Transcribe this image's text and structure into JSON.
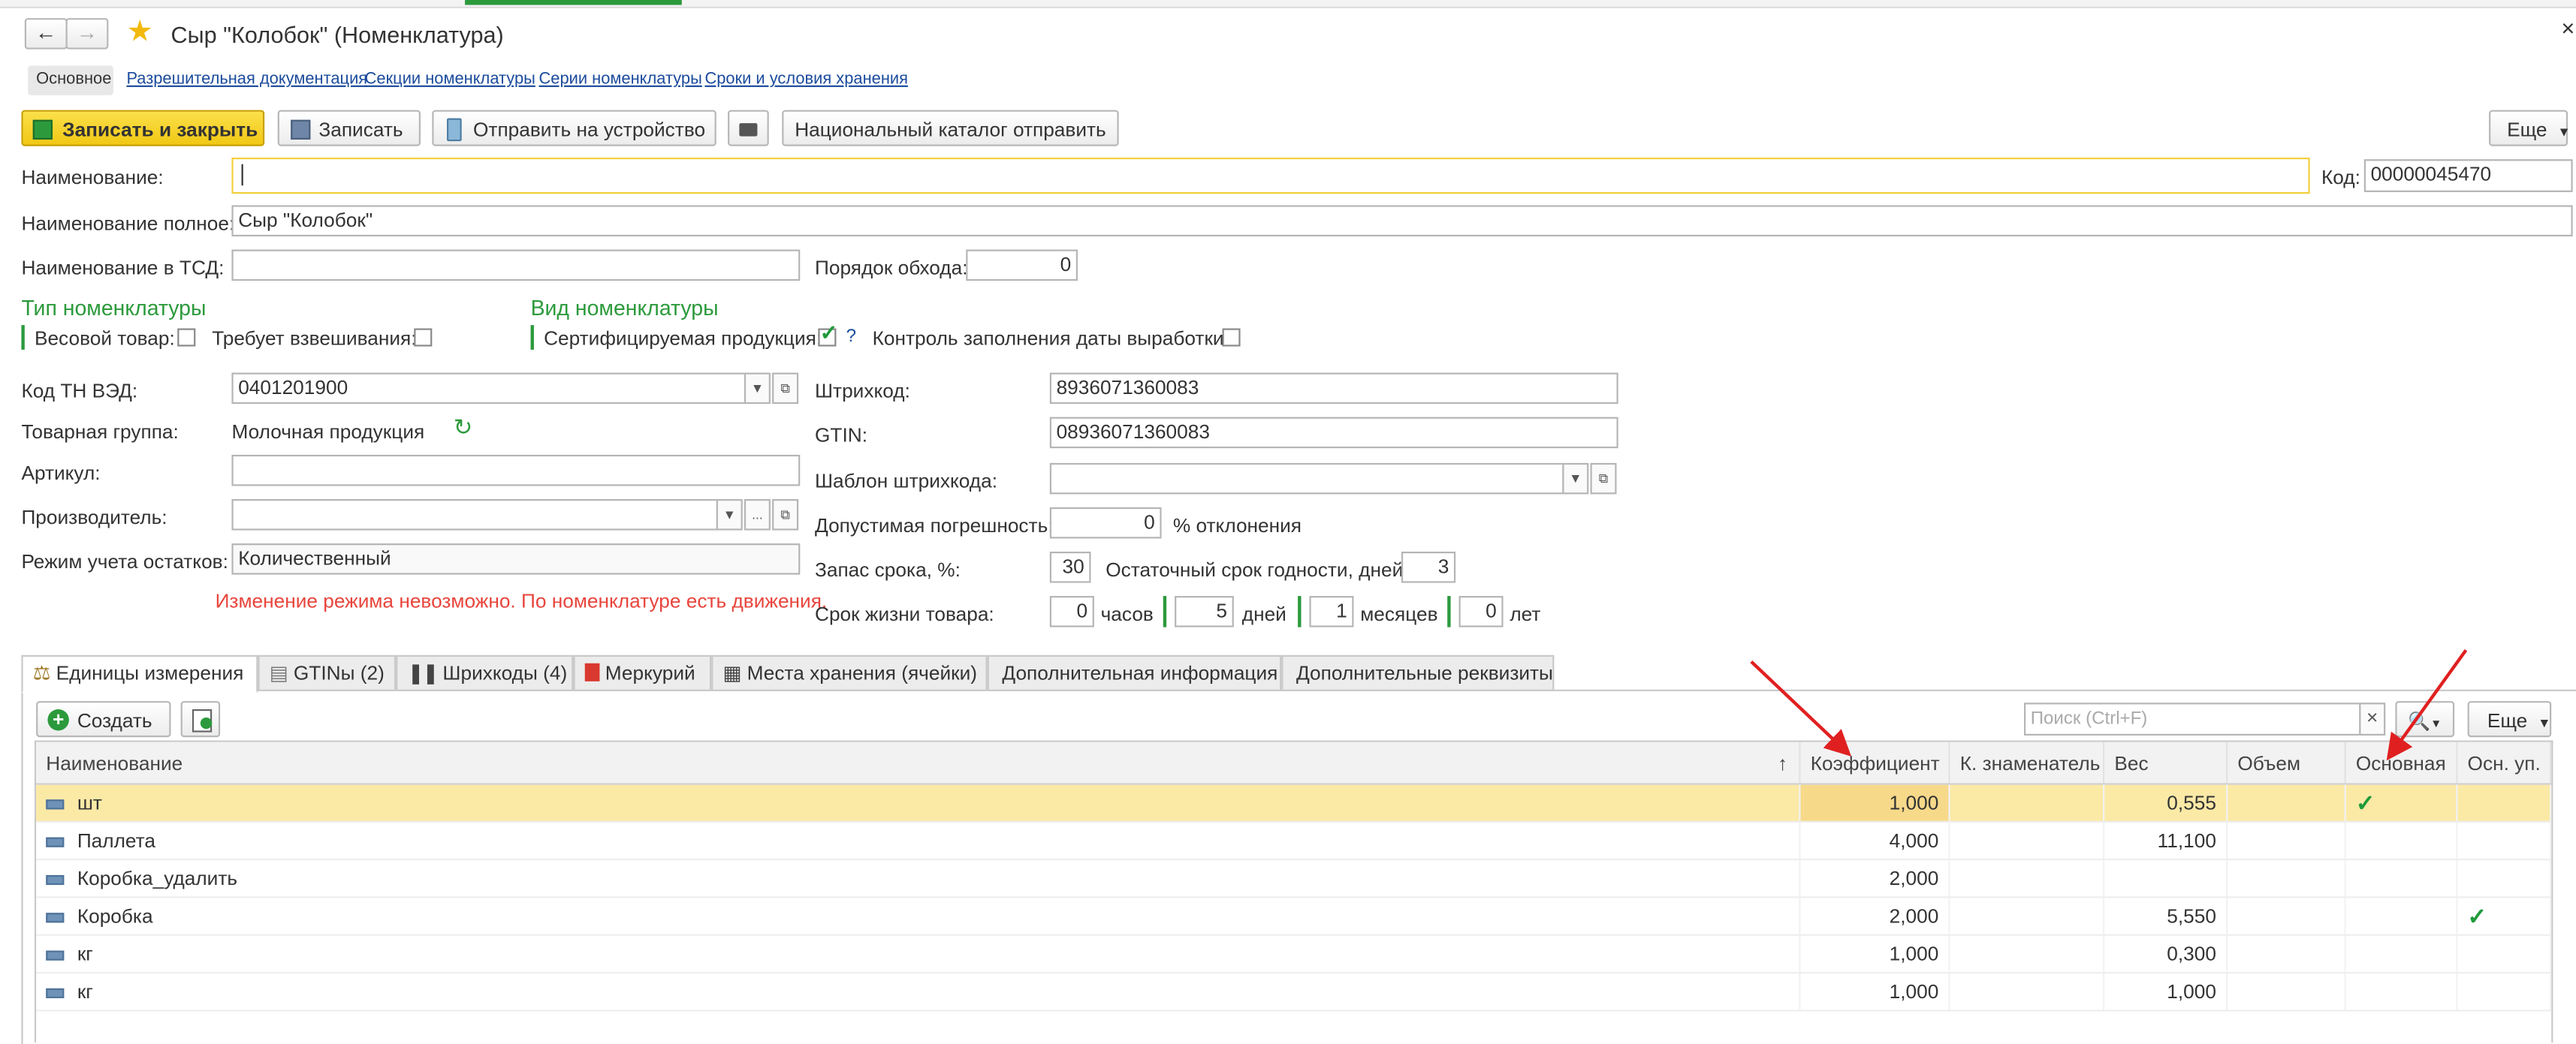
{
  "window": {
    "title": "Сыр \"Колобок\" (Номенклатура)",
    "close_glyph": "×"
  },
  "nav_tabs": [
    {
      "label": "Основное",
      "active": true
    },
    {
      "label": "Разрешительная документация"
    },
    {
      "label": "Секции номенклатуры"
    },
    {
      "label": "Серии номенклатуры"
    },
    {
      "label": "Сроки и условия хранения"
    }
  ],
  "toolbar": {
    "save_close": "Записать и закрыть",
    "save": "Записать",
    "send_device": "Отправить на устройство",
    "national_catalog": "Национальный каталог отправить",
    "more": "Еще"
  },
  "fields": {
    "name_label": "Наименование:",
    "name_value": "",
    "code_label": "Код:",
    "code_value": "00000045470",
    "full_name_label": "Наименование полное:",
    "full_name_value": "Сыр \"Колобок\"",
    "tsd_name_label": "Наименование в ТСД:",
    "tsd_name_value": "",
    "order_label": "Порядок обхода:",
    "order_value": "0"
  },
  "type_section": {
    "title": "Тип номенклатуры",
    "weight_label": "Весовой товар:",
    "weighing_label": "Требует взвешивания:"
  },
  "kind_section": {
    "title": "Вид номенклатуры",
    "certified_label": "Сертифицируемая продукция:",
    "help": "?",
    "date_control_label": "Контроль заполнения даты выработки:"
  },
  "left_fields": {
    "tnved_label": "Код ТН ВЭД:",
    "tnved_value": "0401201900",
    "group_label": "Товарная группа:",
    "group_value": "Молочная продукция",
    "article_label": "Артикул:",
    "article_value": "",
    "producer_label": "Производитель:",
    "producer_value": "",
    "stock_mode_label": "Режим учета остатков:",
    "stock_mode_value": "Количественный",
    "warning": "Изменение режима невозможно. По номенклатуре есть движения."
  },
  "right_fields": {
    "barcode_label": "Штрихкод:",
    "barcode_value": "8936071360083",
    "gtin_label": "GTIN:",
    "gtin_value": "08936071360083",
    "barcode_template_label": "Шаблон штрихкода:",
    "tolerance_label": "Допустимая погрешность:",
    "tolerance_value": "0",
    "tolerance_unit": "% отклонения",
    "reserve_label": "Запас срока, %:",
    "reserve_value": "30",
    "residual_label": "Остаточный срок годности, дней:",
    "residual_value": "3",
    "life_label": "Срок жизни товара:",
    "hours_value": "0",
    "hours_unit": "часов",
    "days_value": "5",
    "days_unit": "дней",
    "months_value": "1",
    "months_unit": "месяцев",
    "years_value": "0",
    "years_unit": "лет"
  },
  "page_tabs": [
    {
      "label": "Единицы измерения",
      "icon": "scales-icon",
      "active": true
    },
    {
      "label": "GTINы (2)",
      "icon": "list-icon"
    },
    {
      "label": "Шрихкоды (4)",
      "icon": "barcode-icon"
    },
    {
      "label": "Меркурий",
      "icon": "mercury-icon"
    },
    {
      "label": "Места хранения (ячейки)",
      "icon": "shelf-icon"
    },
    {
      "label": "Дополнительная информация"
    },
    {
      "label": "Дополнительные реквизиты"
    }
  ],
  "table_toolbar": {
    "create": "Создать",
    "search_placeholder": "Поиск (Ctrl+F)",
    "clear": "×",
    "more": "Еще"
  },
  "table": {
    "columns": [
      "Наименование",
      "Коэффициент",
      "К. знаменатель",
      "Вес",
      "Объем",
      "Основная",
      "Осн. уп."
    ],
    "sort_glyph": "↑",
    "rows": [
      {
        "name": "шт",
        "coef": "1,000",
        "denom": "",
        "weight": "0,555",
        "volume": "",
        "main": "✓",
        "main_pack": "",
        "selected": true
      },
      {
        "name": "Паллета",
        "coef": "4,000",
        "denom": "",
        "weight": "11,100",
        "volume": "",
        "main": "",
        "main_pack": ""
      },
      {
        "name": "Коробка_удалить",
        "coef": "2,000",
        "denom": "",
        "weight": "",
        "volume": "",
        "main": "",
        "main_pack": ""
      },
      {
        "name": "Коробка",
        "coef": "2,000",
        "denom": "",
        "weight": "5,550",
        "volume": "",
        "main": "",
        "main_pack": "✓"
      },
      {
        "name": "кг",
        "coef": "1,000",
        "denom": "",
        "weight": "0,300",
        "volume": "",
        "main": "",
        "main_pack": ""
      },
      {
        "name": "кг",
        "coef": "1,000",
        "denom": "",
        "weight": "1,000",
        "volume": "",
        "main": "",
        "main_pack": ""
      }
    ]
  },
  "colors": {
    "accent_green": "#2c9a3c",
    "warning_red": "#e8453c",
    "selected_row": "#fbe9a6",
    "primary_button": "#f6d530",
    "annotation_arrow": "#e02020"
  }
}
